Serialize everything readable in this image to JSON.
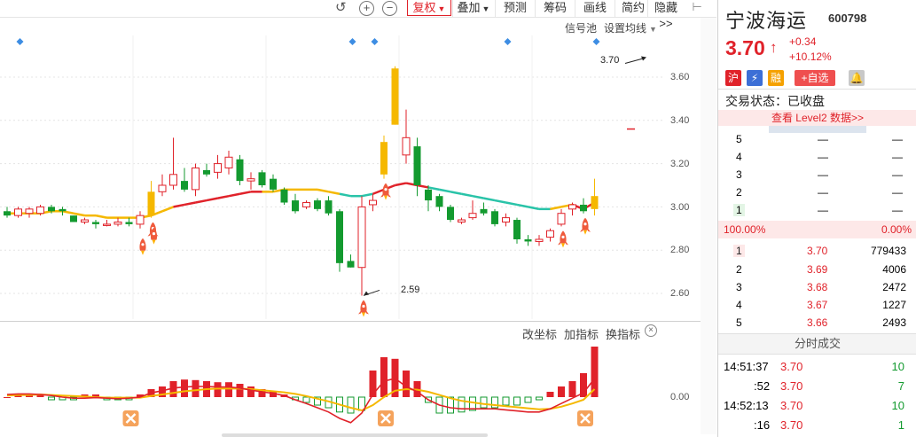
{
  "toolbar": {
    "fuquan_label": "复权",
    "diejia_label": "叠加",
    "yuce_label": "预测",
    "chouma_label": "筹码",
    "huaxian_label": "画线",
    "jianyue_label": "简约",
    "yincang_label": "隐藏>>"
  },
  "main_chart": {
    "signal_pool": "信号池",
    "set_ma": "设置均线",
    "price_annotation_high": "3.70",
    "price_annotation_low": "2.59",
    "y_ticks": [
      "3.60",
      "3.40",
      "3.20",
      "3.00",
      "2.80",
      "2.60"
    ]
  },
  "sub_chart": {
    "change_indicator": "改坐标",
    "add_indicator": "加指标",
    "replace_indicator": "换指标",
    "y_tick": "0.00"
  },
  "quote": {
    "name": "宁波海运",
    "code": "600798",
    "price": "3.70",
    "change": "+0.34",
    "change_pct": "+10.12%",
    "badge_hu": "沪",
    "badge_rong": "融",
    "add_watch": "+自选",
    "status_label": "交易状态：",
    "status_value": "已收盘",
    "level2_link": "查看 Level2 数据>>"
  },
  "order_book": {
    "sell": [
      {
        "level": "5",
        "price": "—",
        "vol": "—"
      },
      {
        "level": "4",
        "price": "—",
        "vol": "—"
      },
      {
        "level": "3",
        "price": "—",
        "vol": "—"
      },
      {
        "level": "2",
        "price": "—",
        "vol": "—"
      },
      {
        "level": "1",
        "price": "—",
        "vol": "—"
      }
    ],
    "ratio_left": "100.00%",
    "ratio_right": "0.00%",
    "buy": [
      {
        "level": "1",
        "price": "3.70",
        "vol": "779433"
      },
      {
        "level": "2",
        "price": "3.69",
        "vol": "4006"
      },
      {
        "level": "3",
        "price": "3.68",
        "vol": "2472"
      },
      {
        "level": "4",
        "price": "3.67",
        "vol": "1227"
      },
      {
        "level": "5",
        "price": "3.66",
        "vol": "2493"
      }
    ]
  },
  "trades": {
    "title": "分时成交",
    "rows": [
      {
        "time": "14:51:37",
        "price": "3.70",
        "vol": "10"
      },
      {
        "time": ":52",
        "price": "3.70",
        "vol": "7"
      },
      {
        "time": "14:52:13",
        "price": "3.70",
        "vol": "10"
      },
      {
        "time": ":16",
        "price": "3.70",
        "vol": "1"
      }
    ]
  },
  "chart_data": {
    "type": "candlestick",
    "price_axis": {
      "min": 2.55,
      "max": 3.7,
      "ticks": [
        3.6,
        3.4,
        3.2,
        3.0,
        2.8,
        2.6
      ]
    },
    "candles": [
      {
        "o": 2.98,
        "h": 3.0,
        "l": 2.95,
        "c": 2.96
      },
      {
        "o": 2.96,
        "h": 3.0,
        "l": 2.95,
        "c": 2.99
      },
      {
        "o": 2.97,
        "h": 3.0,
        "l": 2.95,
        "c": 2.99
      },
      {
        "o": 2.97,
        "h": 3.01,
        "l": 2.96,
        "c": 3.0
      },
      {
        "o": 3.0,
        "h": 3.01,
        "l": 2.97,
        "c": 2.98
      },
      {
        "o": 2.99,
        "h": 3.0,
        "l": 2.96,
        "c": 2.98
      },
      {
        "o": 2.96,
        "h": 2.96,
        "l": 2.93,
        "c": 2.93
      },
      {
        "o": 2.93,
        "h": 2.95,
        "l": 2.92,
        "c": 2.94
      },
      {
        "o": 2.93,
        "h": 2.94,
        "l": 2.9,
        "c": 2.92
      },
      {
        "o": 2.92,
        "h": 2.94,
        "l": 2.91,
        "c": 2.92
      },
      {
        "o": 2.92,
        "h": 2.95,
        "l": 2.91,
        "c": 2.93
      },
      {
        "o": 2.93,
        "h": 2.95,
        "l": 2.91,
        "c": 2.92
      },
      {
        "o": 2.92,
        "h": 2.98,
        "l": 2.9,
        "c": 2.96
      },
      {
        "o": 2.96,
        "h": 3.12,
        "l": 2.95,
        "c": 3.07
      },
      {
        "o": 3.07,
        "h": 3.15,
        "l": 3.05,
        "c": 3.1
      },
      {
        "o": 3.1,
        "h": 3.32,
        "l": 3.08,
        "c": 3.15
      },
      {
        "o": 3.12,
        "h": 3.18,
        "l": 3.07,
        "c": 3.08
      },
      {
        "o": 3.08,
        "h": 3.2,
        "l": 3.05,
        "c": 3.18
      },
      {
        "o": 3.17,
        "h": 3.2,
        "l": 3.14,
        "c": 3.15
      },
      {
        "o": 3.16,
        "h": 3.24,
        "l": 3.13,
        "c": 3.2
      },
      {
        "o": 3.18,
        "h": 3.26,
        "l": 3.15,
        "c": 3.23
      },
      {
        "o": 3.22,
        "h": 3.24,
        "l": 3.1,
        "c": 3.12
      },
      {
        "o": 3.12,
        "h": 3.16,
        "l": 3.08,
        "c": 3.13
      },
      {
        "o": 3.16,
        "h": 3.17,
        "l": 3.09,
        "c": 3.1
      },
      {
        "o": 3.13,
        "h": 3.15,
        "l": 3.07,
        "c": 3.08
      },
      {
        "o": 3.08,
        "h": 3.09,
        "l": 3.01,
        "c": 3.02
      },
      {
        "o": 3.03,
        "h": 3.06,
        "l": 2.97,
        "c": 2.98
      },
      {
        "o": 3.0,
        "h": 3.03,
        "l": 2.99,
        "c": 3.02
      },
      {
        "o": 3.03,
        "h": 3.04,
        "l": 2.98,
        "c": 2.99
      },
      {
        "o": 3.03,
        "h": 3.05,
        "l": 2.96,
        "c": 2.97
      },
      {
        "o": 2.98,
        "h": 2.99,
        "l": 2.7,
        "c": 2.74
      },
      {
        "o": 2.75,
        "h": 2.78,
        "l": 2.72,
        "c": 2.72
      },
      {
        "o": 2.72,
        "h": 3.05,
        "l": 2.59,
        "c": 3.0
      },
      {
        "o": 3.01,
        "h": 3.06,
        "l": 2.98,
        "c": 3.03
      },
      {
        "o": 3.15,
        "h": 3.33,
        "l": 3.13,
        "c": 3.3
      },
      {
        "o": 3.38,
        "h": 3.65,
        "l": 3.38,
        "c": 3.64
      },
      {
        "o": 3.24,
        "h": 3.45,
        "l": 3.2,
        "c": 3.32
      },
      {
        "o": 3.28,
        "h": 3.32,
        "l": 3.05,
        "c": 3.1
      },
      {
        "o": 3.08,
        "h": 3.1,
        "l": 2.98,
        "c": 3.03
      },
      {
        "o": 3.05,
        "h": 3.06,
        "l": 2.98,
        "c": 3.0
      },
      {
        "o": 3.0,
        "h": 3.01,
        "l": 2.93,
        "c": 2.94
      },
      {
        "o": 2.93,
        "h": 2.95,
        "l": 2.92,
        "c": 2.94
      },
      {
        "o": 2.95,
        "h": 3.03,
        "l": 2.94,
        "c": 2.97
      },
      {
        "o": 2.99,
        "h": 3.02,
        "l": 2.96,
        "c": 2.97
      },
      {
        "o": 2.98,
        "h": 2.99,
        "l": 2.91,
        "c": 2.92
      },
      {
        "o": 2.93,
        "h": 2.97,
        "l": 2.91,
        "c": 2.95
      },
      {
        "o": 2.94,
        "h": 2.95,
        "l": 2.83,
        "c": 2.85
      },
      {
        "o": 2.85,
        "h": 2.87,
        "l": 2.82,
        "c": 2.84
      },
      {
        "o": 2.84,
        "h": 2.87,
        "l": 2.82,
        "c": 2.85
      },
      {
        "o": 2.86,
        "h": 2.9,
        "l": 2.84,
        "c": 2.89
      },
      {
        "o": 2.92,
        "h": 2.99,
        "l": 2.91,
        "c": 2.97
      },
      {
        "o": 2.99,
        "h": 3.02,
        "l": 2.96,
        "c": 3.01
      },
      {
        "o": 3.01,
        "h": 3.04,
        "l": 2.97,
        "c": 2.98
      },
      {
        "o": 2.99,
        "h": 3.13,
        "l": 2.96,
        "c": 3.05
      }
    ],
    "ma": [
      2.97,
      2.97,
      2.97,
      2.97,
      2.98,
      2.98,
      2.97,
      2.96,
      2.96,
      2.95,
      2.95,
      2.95,
      2.95,
      2.96,
      2.98,
      3.0,
      3.01,
      3.02,
      3.03,
      3.04,
      3.05,
      3.06,
      3.07,
      3.07,
      3.07,
      3.08,
      3.08,
      3.08,
      3.08,
      3.07,
      3.06,
      3.05,
      3.05,
      3.06,
      3.08,
      3.1,
      3.11,
      3.1,
      3.09,
      3.08,
      3.07,
      3.06,
      3.05,
      3.04,
      3.03,
      3.02,
      3.01,
      3.0,
      2.99,
      2.99,
      3.0,
      3.01,
      2.99,
      3.02
    ],
    "signals_up": [
      13,
      32,
      34,
      50,
      52
    ],
    "signals_x": [
      11,
      34,
      52
    ],
    "top_markers": [
      1,
      31,
      33,
      45,
      53
    ],
    "macd_axis": {
      "min": -1,
      "max": 1
    },
    "macd": [
      0,
      0.05,
      0.05,
      0.05,
      -0.05,
      -0.05,
      -0.05,
      0.05,
      0.05,
      -0.05,
      -0.05,
      -0.05,
      0.05,
      0.15,
      0.2,
      0.3,
      0.33,
      0.32,
      0.3,
      0.28,
      0.28,
      0.25,
      0.2,
      0.15,
      0.1,
      0.05,
      -0.05,
      -0.1,
      -0.15,
      -0.2,
      -0.28,
      -0.3,
      -0.25,
      0.5,
      0.75,
      0.72,
      0.5,
      0.3,
      -0.1,
      -0.3,
      -0.3,
      -0.28,
      -0.25,
      -0.2,
      -0.2,
      -0.15,
      -0.15,
      -0.1,
      -0.05,
      0.1,
      0.2,
      0.3,
      0.45,
      0.95
    ],
    "dif": [
      0.05,
      0.06,
      0.06,
      0.05,
      0.03,
      0.0,
      -0.02,
      -0.02,
      -0.01,
      -0.02,
      -0.03,
      -0.02,
      0.0,
      0.08,
      0.12,
      0.17,
      0.19,
      0.2,
      0.2,
      0.19,
      0.19,
      0.17,
      0.13,
      0.1,
      0.07,
      0.03,
      -0.05,
      -0.12,
      -0.2,
      -0.28,
      -0.4,
      -0.48,
      -0.3,
      0.05,
      0.3,
      0.35,
      0.2,
      0.1,
      -0.05,
      -0.15,
      -0.2,
      -0.22,
      -0.22,
      -0.22,
      -0.22,
      -0.24,
      -0.26,
      -0.28,
      -0.28,
      -0.22,
      -0.12,
      -0.02,
      0.08,
      0.35
    ],
    "dea": [
      0.03,
      0.04,
      0.04,
      0.05,
      0.04,
      0.03,
      0.02,
      0.01,
      0.0,
      -0.01,
      -0.01,
      -0.01,
      -0.01,
      0.02,
      0.05,
      0.08,
      0.11,
      0.13,
      0.15,
      0.16,
      0.16,
      0.16,
      0.15,
      0.13,
      0.11,
      0.09,
      0.06,
      0.02,
      -0.03,
      -0.08,
      -0.14,
      -0.2,
      -0.25,
      -0.15,
      0.0,
      0.12,
      0.15,
      0.14,
      0.1,
      0.04,
      -0.02,
      -0.07,
      -0.1,
      -0.13,
      -0.15,
      -0.17,
      -0.19,
      -0.21,
      -0.23,
      -0.22,
      -0.18,
      -0.12,
      -0.05,
      0.15
    ]
  },
  "colors": {
    "up": "#e0222a",
    "down": "#139a2f",
    "yellow": "#f5b800",
    "cyan": "#29c3a8",
    "blue": "#3d8de3"
  }
}
